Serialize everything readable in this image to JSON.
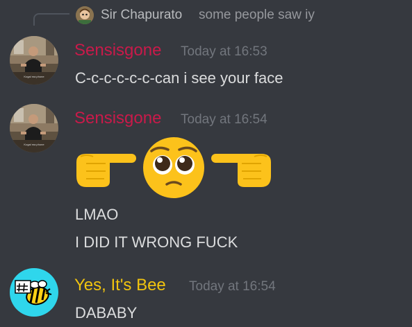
{
  "reply": {
    "author": "Sir Chapurato",
    "text": "some people saw iy",
    "avatar_icon": "cartoon-boy-avatar"
  },
  "messages": [
    {
      "author": "Sensisgone",
      "author_color": "#c91a4a",
      "timestamp": "Today at 16:53",
      "lines": [
        "C-c-c-c-c-c-can i see your face"
      ],
      "avatar_caption": "Kogal ma phone"
    },
    {
      "author": "Sensisgone",
      "author_color": "#c91a4a",
      "timestamp": "Today at 16:54",
      "emojis": [
        "point-right-emoji",
        "pleading-face-emoji",
        "point-left-emoji"
      ],
      "lines": [
        "LMAO",
        "I DID IT WRONG FUCK"
      ],
      "avatar_caption": "Kogal ma phone"
    },
    {
      "author": "Yes, It's Bee",
      "author_color": "#f1c40f",
      "timestamp": "Today at 16:54",
      "lines": [
        "DABABY"
      ],
      "avatar_icon": "hashtag-bee-avatar"
    }
  ],
  "colors": {
    "background": "#36393f",
    "text": "#dcddde",
    "muted": "#72767d"
  }
}
